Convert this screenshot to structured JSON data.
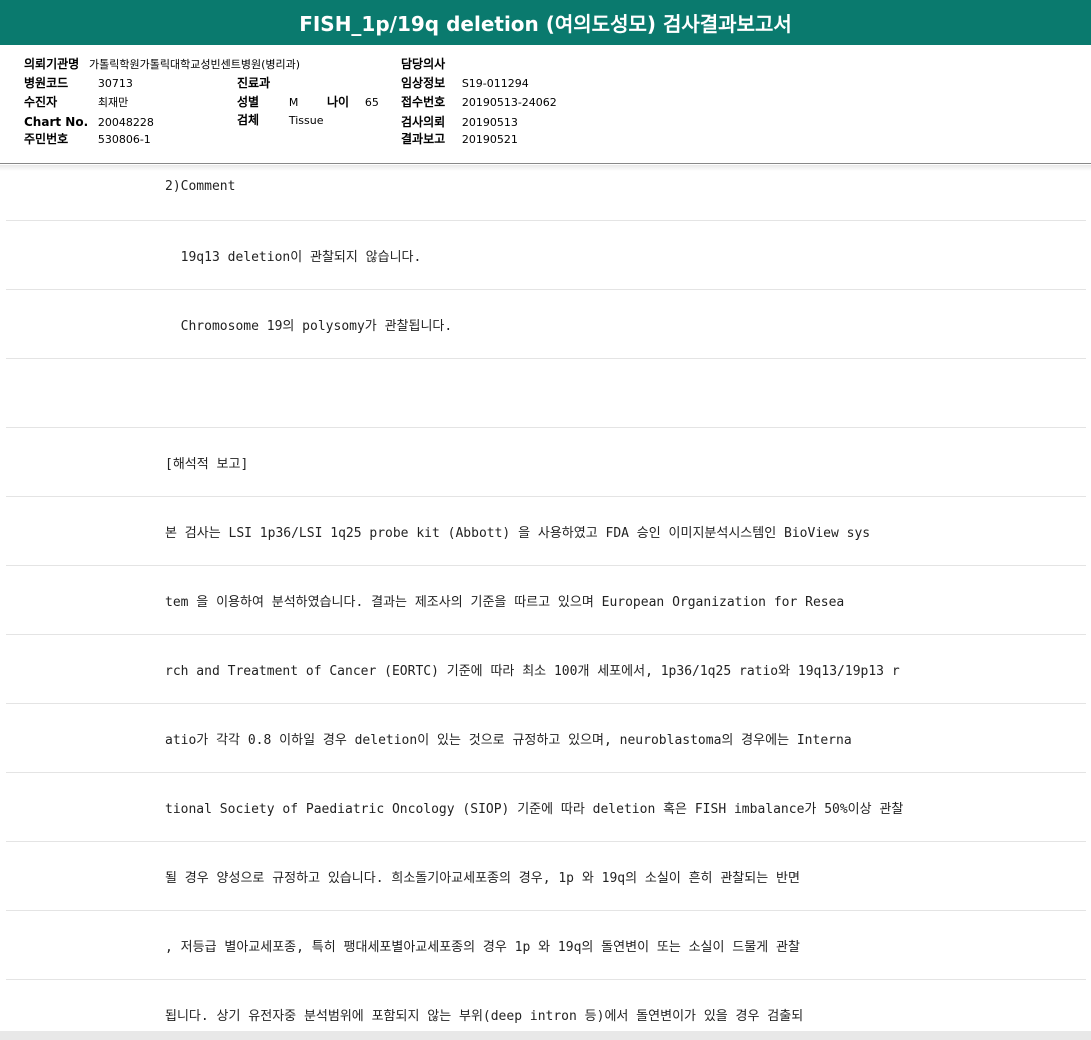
{
  "title": "FISH_1p/19q deletion (여의도성모) 검사결과보고서",
  "header": {
    "institution_label": "의뢰기관명",
    "institution_value": "가톨릭학원가톨릭대학교성빈센트병원(병리과)",
    "hospital_code_label": "병원코드",
    "hospital_code_value": "30713",
    "patient_label": "수진자",
    "patient_value": "최재만",
    "chart_no_label": "Chart No.",
    "chart_no_value": "20048228",
    "resident_no_label": "주민번호",
    "resident_no_value": "530806-1",
    "department_label": "진료과",
    "department_value": "",
    "sex_label": "성별",
    "sex_value": "M",
    "age_label": "나이",
    "age_value": "65",
    "specimen_label": "검체",
    "specimen_value": "Tissue",
    "doctor_label": "담당의사",
    "doctor_value": "",
    "clinical_info_label": "임상정보",
    "clinical_info_value": "S19-011294",
    "receipt_no_label": "접수번호",
    "receipt_no_value": "20190513-24062",
    "request_date_label": "검사의뢰",
    "request_date_value": "20190513",
    "report_date_label": "결과보고",
    "report_date_value": "20190521"
  },
  "body_rows": [
    "2)Comment",
    "  19q13 deletion이 관찰되지 않습니다.",
    "  Chromosome 19의 polysomy가 관찰됩니다.",
    "",
    "[해석적 보고]",
    "본 검사는 LSI 1p36/LSI 1q25 probe kit (Abbott) 을 사용하였고 FDA 승인 이미지분석시스템인 BioView sys",
    "tem 을 이용하여 분석하였습니다. 결과는 제조사의 기준을 따르고 있으며 European Organization for Resea",
    "rch and Treatment of Cancer (EORTC) 기준에 따라 최소 100개 세포에서, 1p36/1q25 ratio와 19q13/19p13 r",
    "atio가 각각 0.8 이하일 경우 deletion이 있는 것으로 규정하고 있으며, neuroblastoma의 경우에는 Interna",
    "tional Society of Paediatric Oncology (SIOP) 기준에 따라 deletion 혹은 FISH imbalance가 50%이상 관찰",
    "될 경우 양성으로 규정하고 있습니다. 희소돌기아교세포종의 경우, 1p 와 19q의 소실이 흔히 관찰되는 반면",
    ", 저등급 별아교세포종, 특히 팽대세포별아교세포종의 경우 1p 와 19q의 돌연변이 또는 소실이 드물게 관찰",
    "됩니다. 상기 유전자중 분석범위에 포함되지 않는 부위(deep intron 등)에서 돌연변이가 있을 경우 검출되"
  ]
}
